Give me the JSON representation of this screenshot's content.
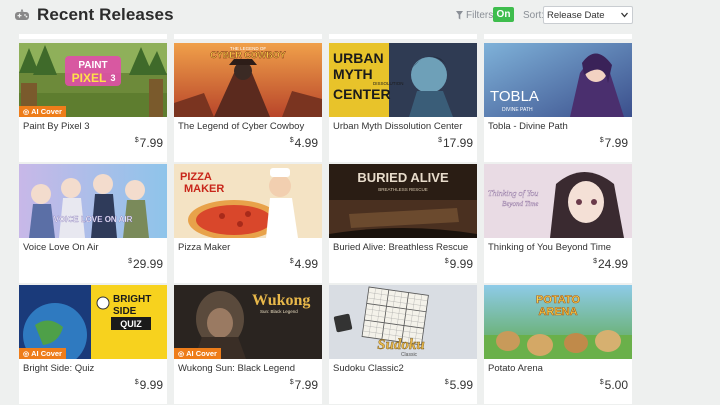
{
  "header": {
    "title": "Recent Releases",
    "filters_label": "Filters:",
    "filters_toggle": "On",
    "sort_label": "Sort:",
    "sort_value": "Release Date"
  },
  "currency_symbol": "$",
  "badge_label": "AI Cover",
  "games": [
    {
      "title": "Paint By Pixel 3",
      "price": "7.99",
      "ai_cover": true,
      "art": "paint-by-pixel"
    },
    {
      "title": "The Legend of Cyber Cowboy",
      "price": "4.99",
      "ai_cover": false,
      "art": "cyber-cowboy"
    },
    {
      "title": "Urban Myth Dissolution Center",
      "price": "17.99",
      "ai_cover": false,
      "art": "urban-myth"
    },
    {
      "title": "Tobla - Divine Path",
      "price": "7.99",
      "ai_cover": false,
      "art": "tobla"
    },
    {
      "title": "Voice Love On Air",
      "price": "29.99",
      "ai_cover": false,
      "art": "voice-love"
    },
    {
      "title": "Pizza Maker",
      "price": "4.99",
      "ai_cover": false,
      "art": "pizza-maker"
    },
    {
      "title": "Buried Alive: Breathless Rescue",
      "price": "9.99",
      "ai_cover": false,
      "art": "buried-alive"
    },
    {
      "title": "Thinking of You Beyond Time",
      "price": "24.99",
      "ai_cover": false,
      "art": "thinking-of-you"
    },
    {
      "title": "Bright Side: Quiz",
      "price": "9.99",
      "ai_cover": true,
      "art": "bright-side"
    },
    {
      "title": "Wukong Sun: Black Legend",
      "price": "7.99",
      "ai_cover": true,
      "art": "wukong"
    },
    {
      "title": "Sudoku Classic2",
      "price": "5.99",
      "ai_cover": false,
      "art": "sudoku"
    },
    {
      "title": "Potato Arena",
      "price": "5.00",
      "ai_cover": false,
      "art": "potato-arena"
    }
  ],
  "cover_text": {
    "paint_line1": "PAINT",
    "paint_line2": "PIXEL",
    "paint_num": "3",
    "cowboy_small": "THE LEGEND OF",
    "cowboy_big": "CYBER COWBOY",
    "urban_1": "URBAN",
    "urban_2": "MYTH",
    "urban_3": "CENTER",
    "urban_sub": "DISSOLUTION",
    "tobla": "TOBLA",
    "tobla_sub": "DIVINE PATH",
    "voice": "VOICE LOVE ON AIR",
    "pizza_1": "PIZZA",
    "pizza_2": "MAKER",
    "buried": "BURIED ALIVE",
    "buried_sub": "BREATHLESS RESCUE",
    "thinking_1": "Thinking of You",
    "thinking_2": "Beyond Time",
    "bright_1": "BRIGHT",
    "bright_2": "SIDE",
    "bright_3": "QUIZ",
    "wukong": "Wukong",
    "wukong_sub": "Sun: Black Legend",
    "sudoku": "Sudoku",
    "sudoku_sub": "Classic",
    "potato_1": "POTATO",
    "potato_2": "ARENA"
  },
  "colors": {
    "accent_green": "#3ebd4d",
    "badge_orange": "#ee7d1a",
    "background": "#eef0ef"
  }
}
